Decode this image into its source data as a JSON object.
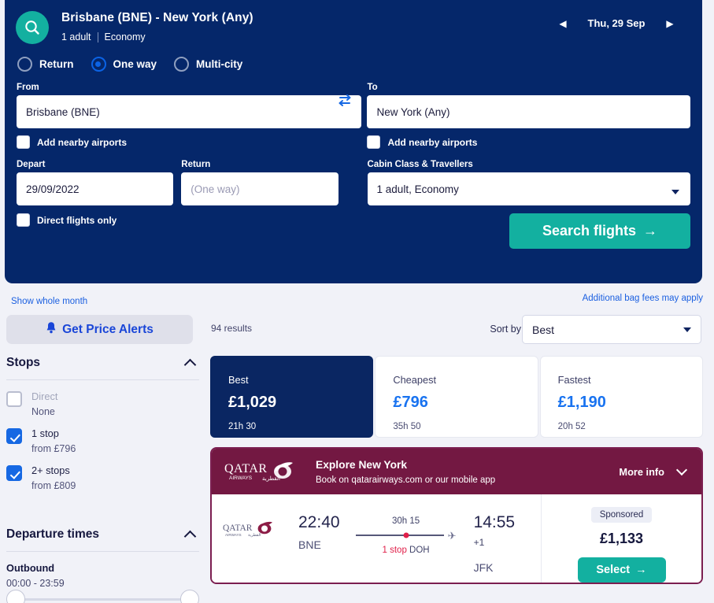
{
  "search_panel": {
    "logo_icon": "search-icon",
    "route_title": "Brisbane (BNE) - New York (Any)",
    "passengers": "1 adult",
    "cabin": "Economy",
    "date_nav": {
      "prev_icon": "◀",
      "date_label": "Thu, 29 Sep",
      "next_icon": "▶"
    },
    "trip_types": [
      {
        "label": "Return",
        "checked": false
      },
      {
        "label": "One way",
        "checked": true
      },
      {
        "label": "Multi-city",
        "checked": false
      }
    ],
    "from": {
      "label": "From",
      "value": "Brisbane (BNE)",
      "nearby_label": "Add nearby airports",
      "nearby_checked": false
    },
    "to": {
      "label": "To",
      "value": "New York (Any)",
      "nearby_label": "Add nearby airports",
      "nearby_checked": false
    },
    "swap_icon": "swap-icon",
    "depart": {
      "label": "Depart",
      "value": "29/09/2022"
    },
    "return": {
      "label": "Return",
      "placeholder": "(One way)",
      "value": ""
    },
    "cabin_class": {
      "label": "Cabin Class & Travellers",
      "value": "1 adult, Economy"
    },
    "direct_only": {
      "label": "Direct flights only",
      "checked": false
    },
    "search_button": "Search flights",
    "search_button_arrow": "→"
  },
  "links": {
    "show_whole_month": "Show whole month",
    "bag_fees": "Additional bag fees may apply"
  },
  "toolbar": {
    "price_alerts": "Get Price Alerts",
    "bell_icon": "bell-icon",
    "results_count": "94 results",
    "sort_by_label": "Sort by",
    "sort_value": "Best"
  },
  "sidebar": {
    "stops": {
      "title": "Stops",
      "options": [
        {
          "name": "Direct",
          "sub": "None",
          "checked": false,
          "disabled": true
        },
        {
          "name": "1 stop",
          "sub": "from £796",
          "checked": true,
          "disabled": false
        },
        {
          "name": "2+ stops",
          "sub": "from £809",
          "checked": true,
          "disabled": false
        }
      ]
    },
    "departure_times": {
      "title": "Departure times",
      "outbound_label": "Outbound",
      "outbound_range": "00:00 - 23:59"
    }
  },
  "price_tabs": [
    {
      "label": "Best",
      "price": "£1,029",
      "duration": "21h 30",
      "active": true
    },
    {
      "label": "Cheapest",
      "price": "£796",
      "duration": "35h 50",
      "active": false
    },
    {
      "label": "Fastest",
      "price": "£1,190",
      "duration": "20h 52",
      "active": false
    }
  ],
  "sponsor": {
    "airline_name": "QATAR",
    "airline_sub": "AIRWAYS",
    "title": "Explore New York",
    "subtitle": "Book on qatarairways.com or our mobile app",
    "more_info": "More info",
    "brand_color": "#731842"
  },
  "flight": {
    "airline_logo": "qatar-airways-logo",
    "depart_time": "22:40",
    "depart_code": "BNE",
    "duration": "30h 15",
    "stops_text": "1 stop",
    "stop_code": "DOH",
    "arrive_time": "14:55",
    "plus_days": "+1",
    "arrive_code": "JFK",
    "badge": "Sponsored",
    "price": "£1,133",
    "select_label": "Select",
    "select_arrow": "→"
  },
  "colors": {
    "navy": "#05276a",
    "teal": "#13b0a0",
    "blue": "#1668e3",
    "qatar_maroon": "#731842",
    "page_bg": "#f1f2f8"
  }
}
